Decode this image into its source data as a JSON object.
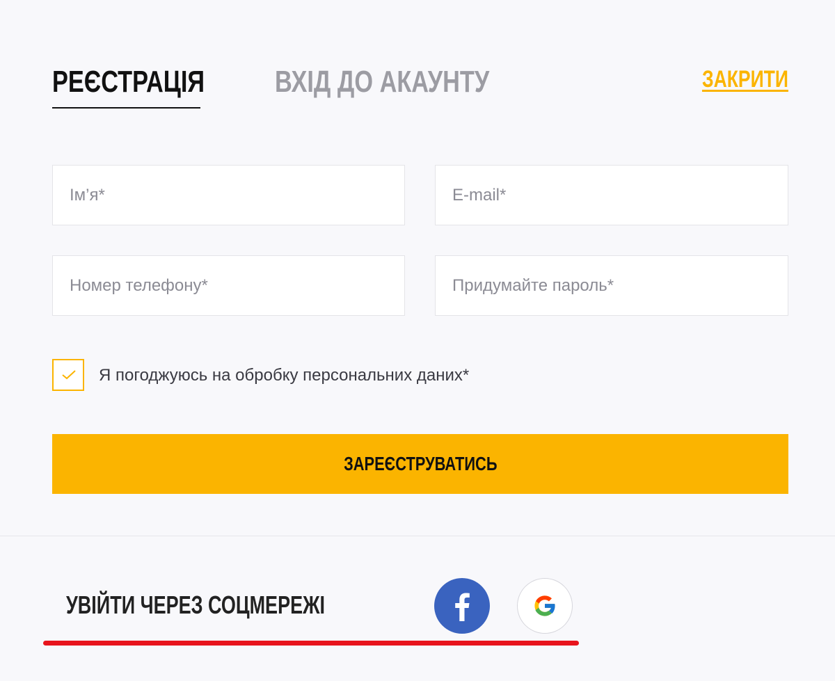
{
  "tabs": {
    "register": "РЕЄСТРАЦІЯ",
    "login": "ВХІД ДО АКАУНТУ",
    "active": "register"
  },
  "close_label": "ЗАКРИТИ",
  "form": {
    "name_placeholder": "Ім’я*",
    "email_placeholder": "E-mail*",
    "phone_placeholder": "Номер телефону*",
    "password_placeholder": "Придумайте пароль*",
    "consent_label": "Я погоджуюсь на обробку персональних даних*",
    "consent_checked": true,
    "submit_label": "ЗАРЕЄСТРУВАТИСЬ"
  },
  "social": {
    "label": "УВІЙТИ ЧЕРЕЗ СОЦМЕРЕЖІ",
    "facebook_icon": "facebook-icon",
    "google_icon": "google-icon"
  },
  "colors": {
    "accent": "#fbb400",
    "facebook": "#3a63bf",
    "annotation_red": "#e8141c"
  }
}
